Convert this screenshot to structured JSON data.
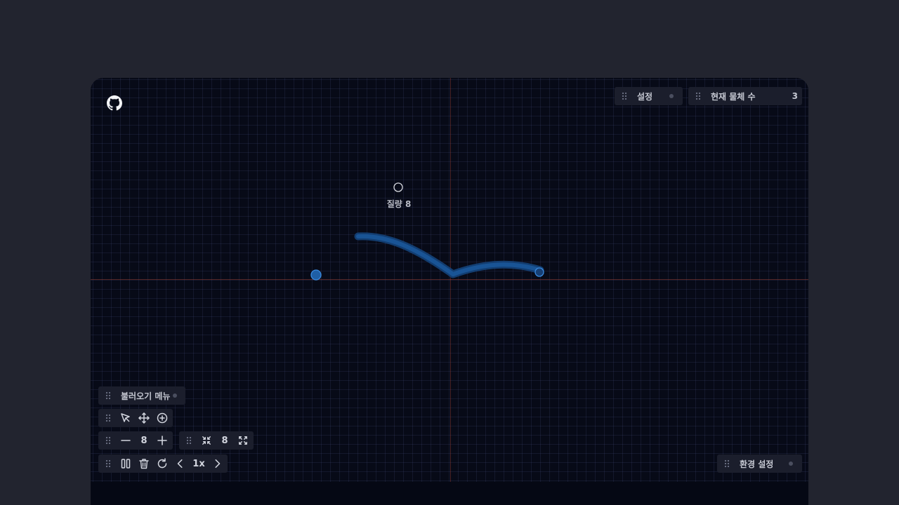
{
  "header": {
    "settings_label": "설정",
    "object_count_label": "현재 물체 수",
    "object_count_value": "3"
  },
  "scene": {
    "mass_label": "질량 8"
  },
  "toolbar": {
    "load_menu_label": "불러오기 메뉴",
    "mass_value": "8",
    "size_value": "8",
    "speed_value": "1x",
    "environment_label": "환경 설정"
  },
  "icons": {
    "logo": "github-icon",
    "select": "cursor-icon",
    "move": "move-icon",
    "add": "plus-circle-icon",
    "minus": "minus-icon",
    "plus": "plus-icon",
    "shrink": "shrink-icon",
    "expand": "expand-icon",
    "pause": "pause-icon",
    "delete": "trash-icon",
    "reset": "refresh-icon",
    "prev": "chevron-left-icon",
    "next": "chevron-right-icon"
  },
  "colors": {
    "background": "#22242f",
    "canvas": "#070a17",
    "panel": "#1b1e2c",
    "trail": "#1e5fa8",
    "body_blue": "#2a7fd4",
    "axis": "#7a3028"
  }
}
